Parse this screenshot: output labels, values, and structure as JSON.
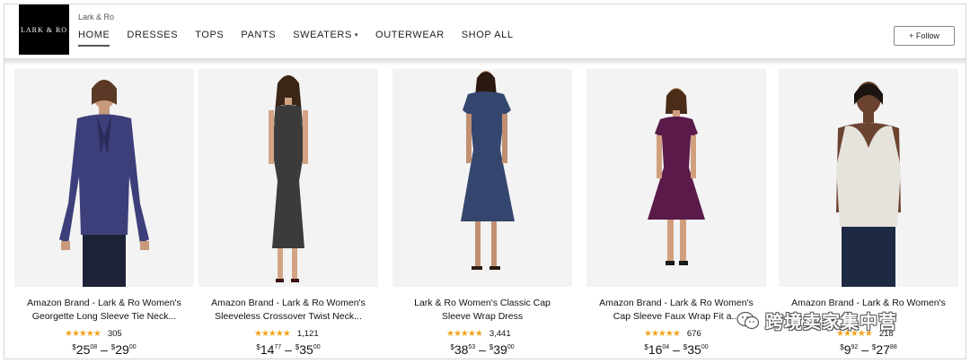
{
  "store": {
    "logo_text": "LARK & RO",
    "name": "Lark & Ro",
    "follow_label": "+ Follow"
  },
  "nav": {
    "items": [
      {
        "label": "HOME",
        "active": true
      },
      {
        "label": "DRESSES"
      },
      {
        "label": "TOPS"
      },
      {
        "label": "PANTS"
      },
      {
        "label": "SWEATERS"
      },
      {
        "label": "OUTERWEAR"
      },
      {
        "label": "SHOP ALL"
      }
    ],
    "dropdown_caret": "▾"
  },
  "products": [
    {
      "title_line1": "Amazon Brand - Lark & Ro Women's",
      "title_line2": "Georgette Long Sleeve Tie Neck...",
      "stars": "★★★★★",
      "rating": 4.5,
      "reviews": "305",
      "price_low": {
        "currency": "$",
        "whole": "25",
        "cents": "08"
      },
      "price_high": {
        "currency": "$",
        "whole": "29",
        "cents": "00"
      },
      "garment_color": "#3d3f7a",
      "garment_icon": "long-sleeve-blouse"
    },
    {
      "title_line1": "Amazon Brand - Lark & Ro Women's",
      "title_line2": "Sleeveless Crossover Twist Neck...",
      "stars": "★★★★★",
      "rating": 4.5,
      "reviews": "1,121",
      "price_low": {
        "currency": "$",
        "whole": "14",
        "cents": "77"
      },
      "price_high": {
        "currency": "$",
        "whole": "35",
        "cents": "00"
      },
      "garment_color": "#3b3b3b",
      "garment_icon": "sheath-dress"
    },
    {
      "title_line1": "Lark & Ro Women's Classic Cap",
      "title_line2": "Sleeve Wrap Dress",
      "stars": "★★★★★",
      "rating": 4.5,
      "reviews": "3,441",
      "price_low": {
        "currency": "$",
        "whole": "38",
        "cents": "53"
      },
      "price_high": {
        "currency": "$",
        "whole": "39",
        "cents": "00"
      },
      "garment_color": "#35466e",
      "garment_icon": "wrap-dress"
    },
    {
      "title_line1": "Amazon Brand - Lark & Ro Women's",
      "title_line2": "Cap Sleeve Faux Wrap Fit a...",
      "stars": "★★★★★",
      "rating": 4.5,
      "reviews": "676",
      "price_low": {
        "currency": "$",
        "whole": "16",
        "cents": "04"
      },
      "price_high": {
        "currency": "$",
        "whole": "35",
        "cents": "00"
      },
      "garment_color": "#5a1a4a",
      "garment_icon": "fit-and-flare-dress"
    },
    {
      "title_line1": "Amazon Brand - Lark & Ro Women's",
      "title_line2": "",
      "stars": "★★★★★",
      "rating": 4.5,
      "reviews": "218",
      "price_low": {
        "currency": "$",
        "whole": "9",
        "cents": "92"
      },
      "price_high": {
        "currency": "$",
        "whole": "27",
        "cents": "88"
      },
      "garment_color": "#e6e3dc",
      "garment_icon": "sleeveless-top"
    }
  ],
  "watermark": {
    "text": "跨境卖家集中营",
    "icon": "wechat-icon"
  },
  "colors": {
    "star": "#f0a41c",
    "thumb_bg": "#f3f3f3",
    "logo_bg": "#000000"
  }
}
